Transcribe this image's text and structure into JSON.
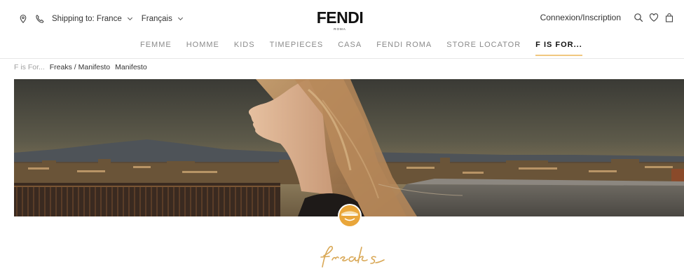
{
  "topbar": {
    "shipping_label": "Shipping to: France",
    "language_label": "Français",
    "brand": "FENDI",
    "brand_sub": "ROMA",
    "login_label": "Connexion/Inscription",
    "icons": [
      "location-icon",
      "phone-icon",
      "search-icon",
      "heart-icon",
      "bag-icon"
    ]
  },
  "nav": {
    "items": [
      {
        "label": "FEMME"
      },
      {
        "label": "HOMME"
      },
      {
        "label": "KIDS"
      },
      {
        "label": "TIMEPIECES"
      },
      {
        "label": "CASA"
      },
      {
        "label": "FENDI ROMA"
      },
      {
        "label": "STORE LOCATOR"
      },
      {
        "label": "F IS FOR..."
      }
    ],
    "active_index": 7
  },
  "breadcrumb": {
    "root": "F is For...",
    "section": "Freaks / Manifesto",
    "current": "Manifesto"
  },
  "hero": {
    "title_script": "freaks",
    "accent_color": "#f0c880",
    "emblem_color": "#e9a63a"
  }
}
